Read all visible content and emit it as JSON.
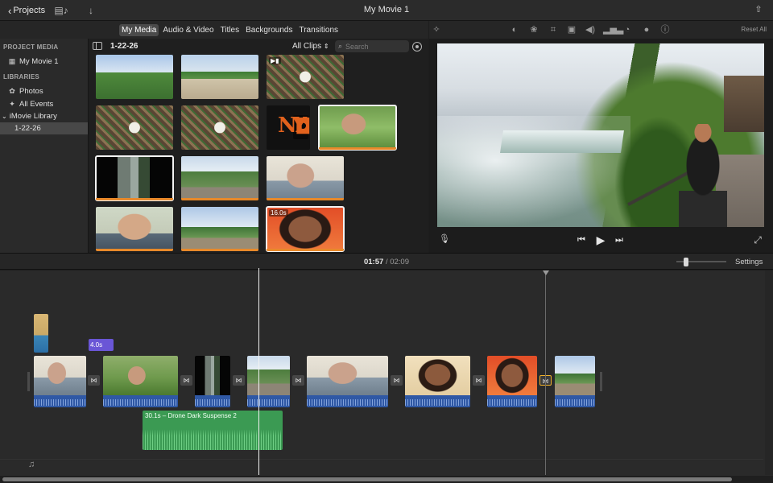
{
  "titlebar": {
    "back_label": "Projects",
    "title": "My Movie 1"
  },
  "media_tabs": [
    "My Media",
    "Audio & Video",
    "Titles",
    "Backgrounds",
    "Transitions"
  ],
  "adjust_bar": {
    "reset_all": "Reset All",
    "icons": [
      "magic-wand-icon",
      "color-balance-icon",
      "color-correction-icon",
      "crop-icon",
      "stabilization-icon",
      "volume-icon",
      "equalizer-icon",
      "speed-icon",
      "video-filter-icon",
      "info-icon"
    ]
  },
  "sidebar": {
    "project_media_header": "PROJECT MEDIA",
    "project_item": "My Movie 1",
    "libraries_header": "LIBRARIES",
    "photos": "Photos",
    "all_events": "All Events",
    "library": "iMovie Library",
    "event": "1-22-26"
  },
  "browser": {
    "event_title": "1-22-26",
    "filter": "All Clips",
    "search_placeholder": "Search",
    "clips": [
      {
        "style": "sky",
        "used": false
      },
      {
        "style": "sand",
        "used": false
      },
      {
        "style": "clover",
        "used": false,
        "badge": "video-camera-icon"
      },
      {
        "style": "clover",
        "used": false
      },
      {
        "style": "clover",
        "used": false
      },
      {
        "style": "logo",
        "used": false,
        "badge": "camera-icon"
      },
      {
        "style": "girl-park",
        "used": true,
        "selected": true
      },
      {
        "style": "falls-dark",
        "used": true,
        "selected": true
      },
      {
        "style": "hike",
        "used": true
      },
      {
        "style": "face-indoor",
        "used": true
      },
      {
        "style": "face",
        "used": true
      },
      {
        "style": "park",
        "used": true
      },
      {
        "style": "girl-orange",
        "used": true,
        "selected": true,
        "duration": "16.0s"
      }
    ]
  },
  "viewer": {
    "controls": [
      "skip-back-icon",
      "play-icon",
      "skip-forward-icon"
    ]
  },
  "timebar": {
    "current": "01:57",
    "separator": "/",
    "total": "02:09",
    "settings": "Settings",
    "zoom_level": 0.2
  },
  "timeline": {
    "title_duration": "4.0s",
    "music_label": "30.1s – Drone Dark Suspense 2",
    "transition_icon": "⋈"
  },
  "colors": {
    "accent_orange": "#e8892a",
    "audio_blue": "#2f58a5",
    "music_green": "#3b9a53",
    "title_purple": "#6a56d6",
    "selected_transition": "#f0b12a"
  }
}
